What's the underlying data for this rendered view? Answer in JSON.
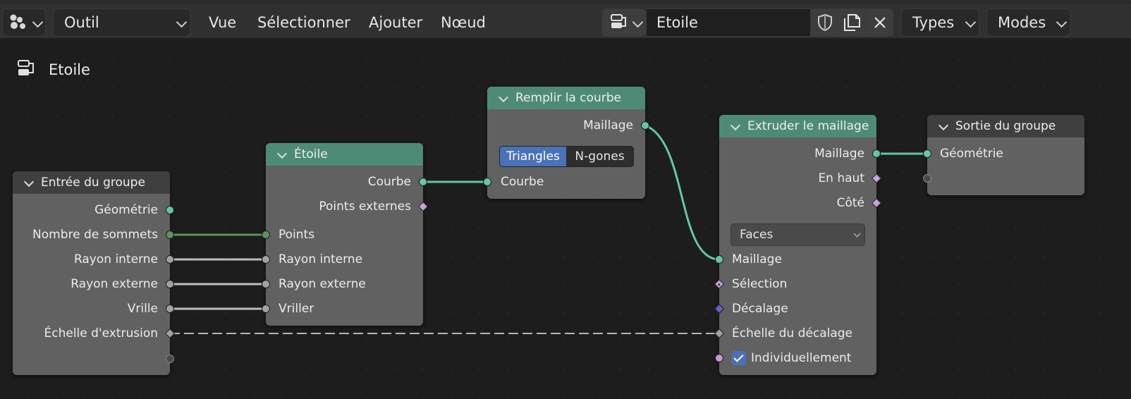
{
  "header": {
    "editor_type": "node-editor-icon",
    "tool_label": "Outil",
    "menus": [
      "Vue",
      "Sélectionner",
      "Ajouter",
      "Nœud"
    ],
    "tree_name": "Etoile",
    "types_label": "Types",
    "modes_label": "Modes"
  },
  "breadcrumb": {
    "icon": "node-tree-icon",
    "label": "Etoile"
  },
  "nodes": {
    "group_input": {
      "title": "Entrée du groupe",
      "outputs": [
        "Géométrie",
        "Nombre de sommets",
        "Rayon interne",
        "Rayon externe",
        "Vrille",
        "Échelle d'extrusion"
      ]
    },
    "star": {
      "title": "Étoile",
      "outputs": [
        "Courbe",
        "Points externes"
      ],
      "inputs": [
        "Points",
        "Rayon interne",
        "Rayon externe",
        "Vriller"
      ]
    },
    "fill_curve": {
      "title": "Remplir la courbe",
      "output": "Maillage",
      "mode_options": [
        "Triangles",
        "N-gones"
      ],
      "mode_selected": "Triangles",
      "input": "Courbe"
    },
    "extrude_mesh": {
      "title": "Extruder le maillage",
      "outputs": [
        "Maillage",
        "En haut",
        "Côté"
      ],
      "mode": "Faces",
      "inputs": [
        "Maillage",
        "Sélection",
        "Décalage",
        "Échelle du décalage"
      ],
      "individual_label": "Individuellement",
      "individual_checked": true
    },
    "group_output": {
      "title": "Sortie du groupe",
      "input": "Géométrie"
    }
  },
  "colors": {
    "geometry_socket": "#63c7a3",
    "float_socket": "#a1a1a1",
    "int_socket": "#598c5c",
    "bool_socket": "#c6a2d6",
    "vector_socket": "#6362c8",
    "geometry_header": "#4d8b76",
    "group_header": "#3f3f3f",
    "active_blue": "#4a72b8"
  }
}
